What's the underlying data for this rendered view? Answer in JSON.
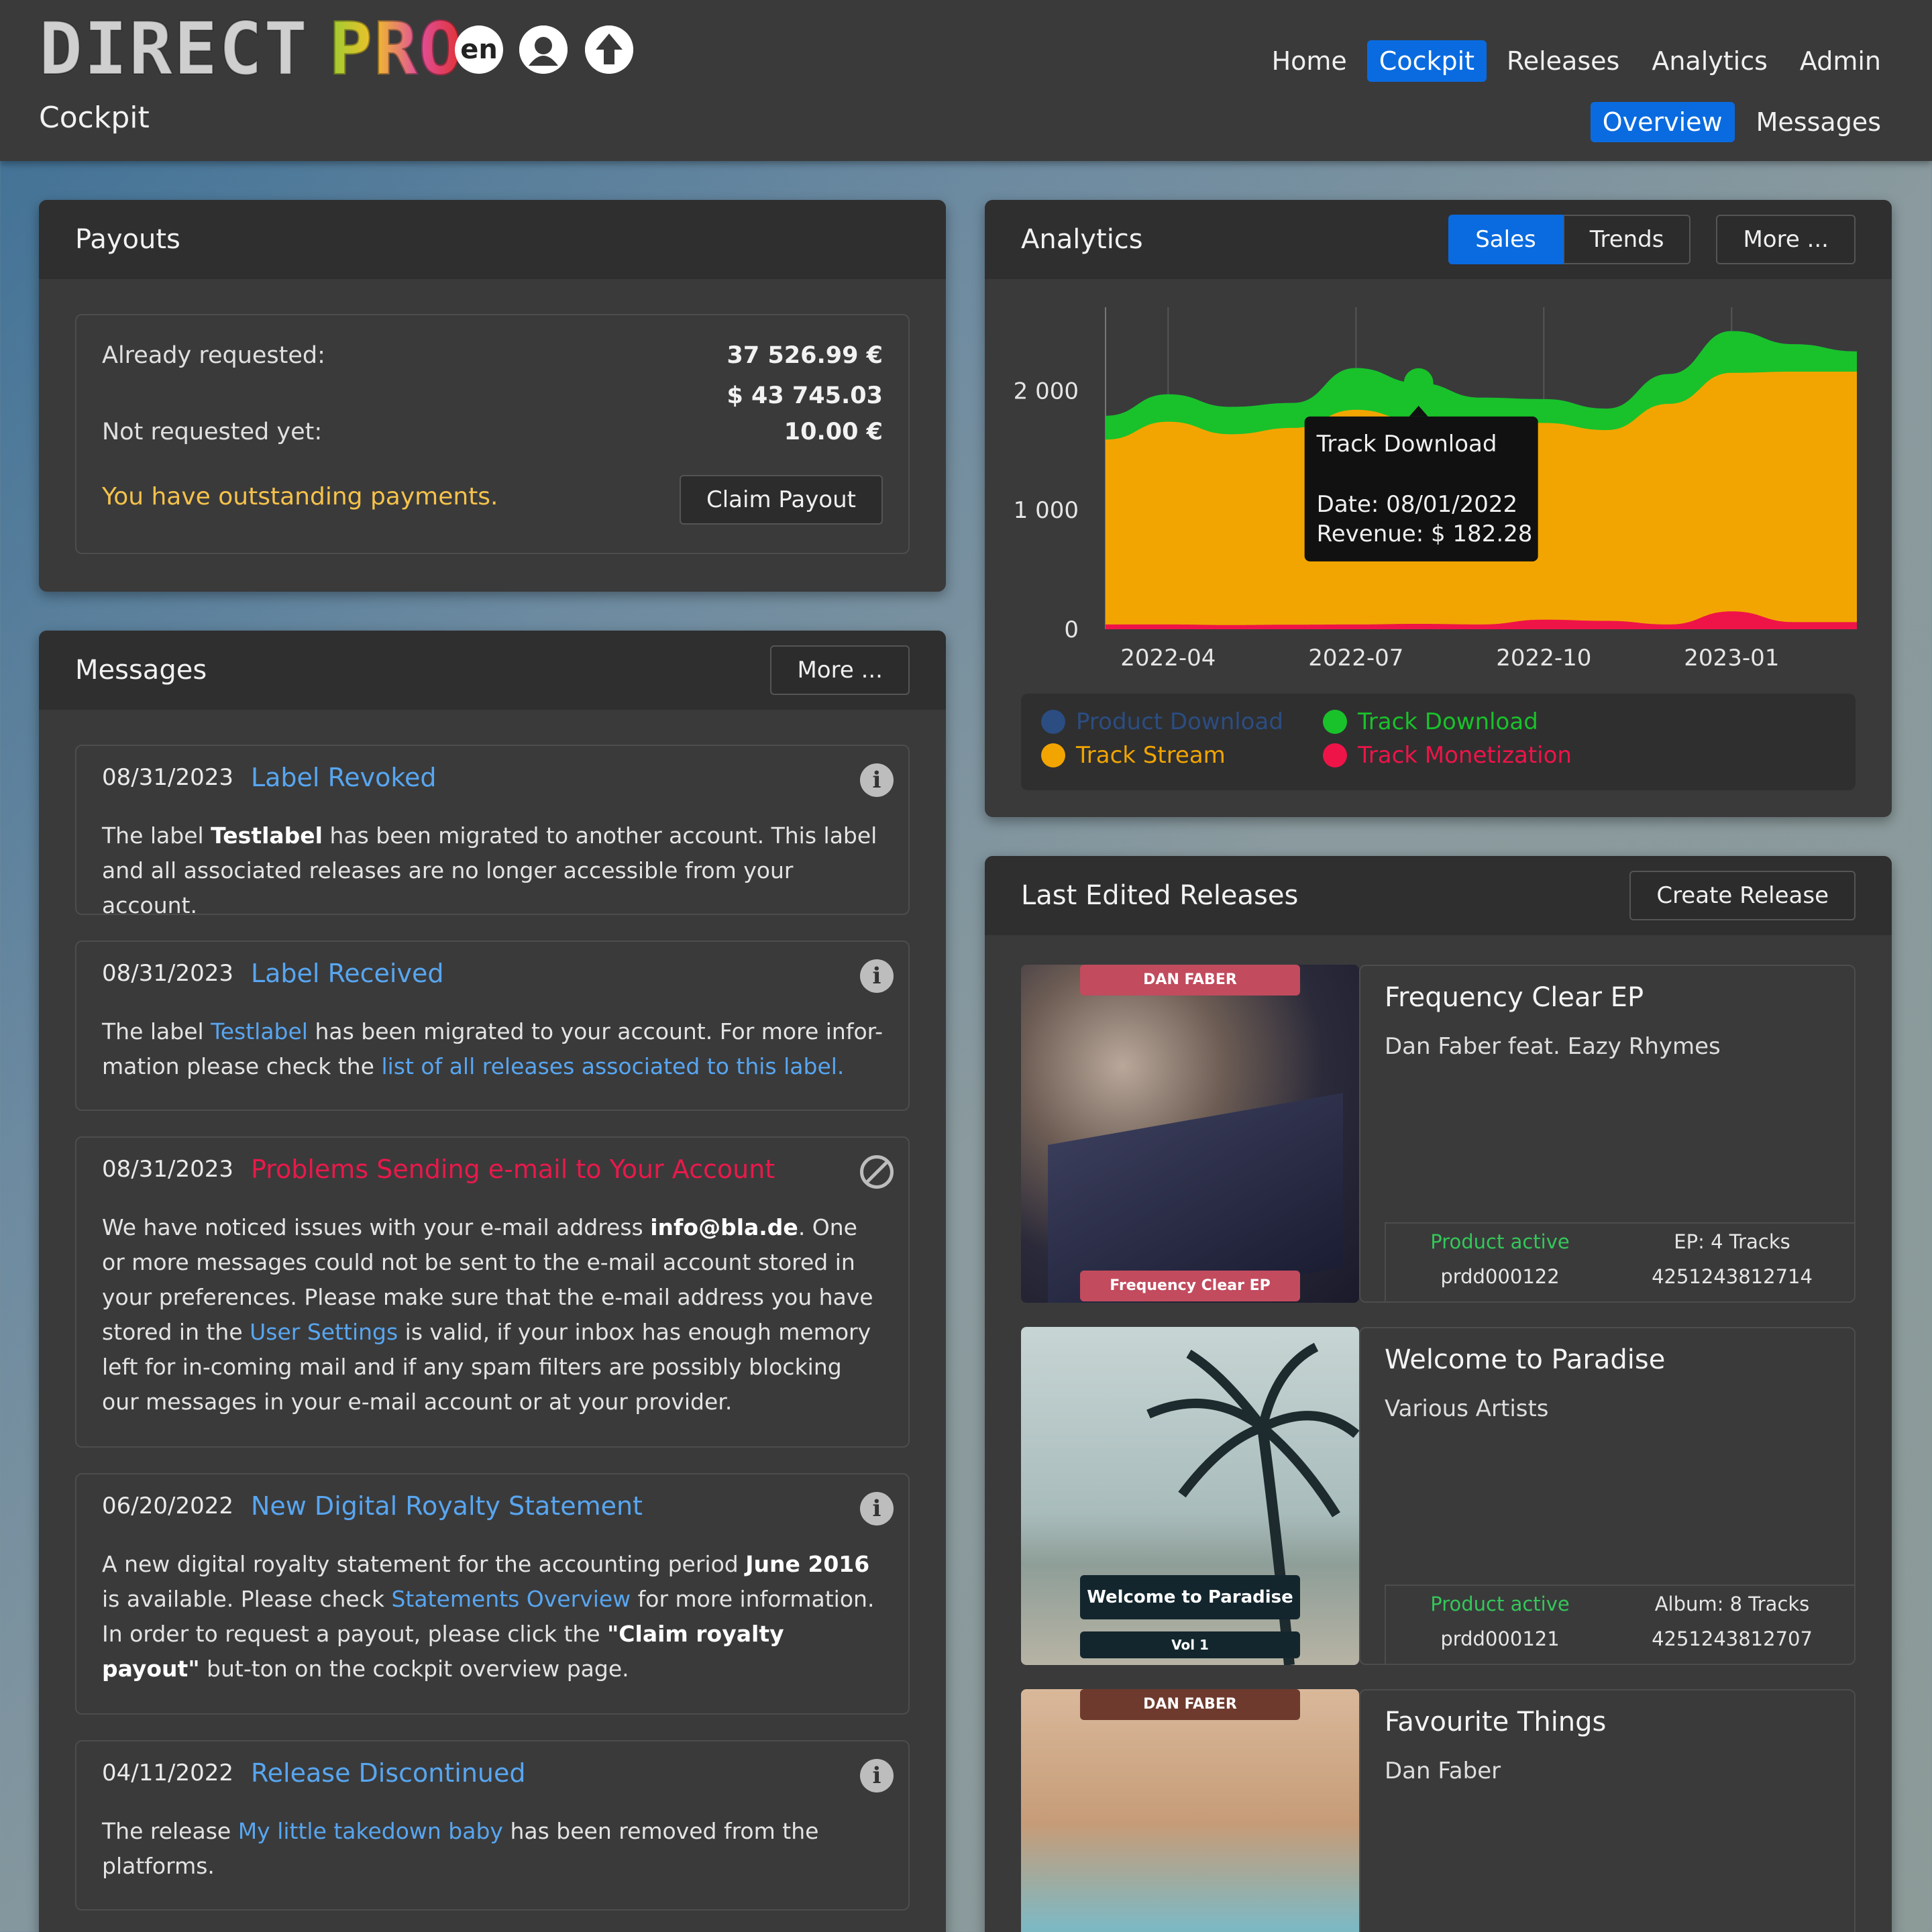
{
  "header": {
    "logo_word1": "DIRECT",
    "logo_word2": "PRO",
    "lang": "en",
    "page_title": "Cockpit",
    "nav": [
      "Home",
      "Cockpit",
      "Releases",
      "Analytics",
      "Admin"
    ],
    "nav_active": "Cockpit",
    "subnav": [
      "Overview",
      "Messages"
    ],
    "subnav_active": "Overview"
  },
  "payouts": {
    "title": "Payouts",
    "already_requested_label": "Already requested:",
    "already_requested_eur": "37 526.99 €",
    "already_requested_usd": "$ 43 745.03",
    "not_requested_label": "Not requested yet:",
    "not_requested_eur": "10.00 €",
    "notice": "You have outstanding payments.",
    "claim_label": "Claim Payout"
  },
  "messages": {
    "title": "Messages",
    "more_label": "More ...",
    "items": [
      {
        "date": "08/31/2023",
        "title": "Label Revoked",
        "icon": "info-icon",
        "body_parts": [
          "The label ",
          "Testlabel",
          " has been migrated to another account. This label and all associated releases are no longer accessible from your account."
        ]
      },
      {
        "date": "08/31/2023",
        "title": "Label Received",
        "icon": "info-icon",
        "body_parts": [
          "The label ",
          "Testlabel",
          " has been migrated to your account. For more infor-mation please check the ",
          "list of all releases associated to this label."
        ]
      },
      {
        "date": "08/31/2023",
        "title": "Problems Sending e-mail to Your Account",
        "icon": "ban-icon",
        "body_parts": [
          "We have noticed issues with your e-mail address ",
          "info@bla.de",
          ". One or more messages could not be sent to the e-mail account stored in your preferences. Please make sure that the e-mail address you have stored in the ",
          "User Settings",
          " is valid, if your inbox has enough memory left for in-coming mail and if any spam filters are possibly blocking our messages in your e-mail account or at your provider."
        ]
      },
      {
        "date": "06/20/2022",
        "title": "New Digital Royalty Statement",
        "icon": "info-icon",
        "body_parts": [
          "A new digital royalty statement for the accounting period ",
          "June 2016",
          " is available. Please check ",
          "Statements Overview",
          " for more information. In order to request a payout, please click the ",
          "\"Claim royalty payout\"",
          " but-ton on the cockpit overview page."
        ]
      },
      {
        "date": "04/11/2022",
        "title": "Release Discontinued",
        "icon": "info-icon",
        "body_parts": [
          "The release ",
          "My little takedown baby",
          " has been removed from the platforms."
        ]
      }
    ]
  },
  "analytics": {
    "title": "Analytics",
    "tabs": [
      "Sales",
      "Trends"
    ],
    "tab_active": "Sales",
    "more_label": "More ...",
    "tooltip": {
      "series": "Track Download",
      "date_line": "Date: 08/01/2022",
      "revenue_line": "Revenue: $ 182.28"
    },
    "legend": [
      {
        "name": "Product Download",
        "color": "#2b4d82"
      },
      {
        "name": "Track Download",
        "color": "#19c22a"
      },
      {
        "name": "Track Stream",
        "color": "#f2a500"
      },
      {
        "name": "Track Monetization",
        "color": "#ee1448"
      }
    ]
  },
  "chart_data": {
    "type": "area",
    "stacked": true,
    "x": [
      "2022-03",
      "2022-04",
      "2022-05",
      "2022-06",
      "2022-07",
      "2022-08",
      "2022-09",
      "2022-10",
      "2022-11",
      "2022-12",
      "2023-01",
      "2023-02",
      "2023-03"
    ],
    "xticks": [
      "2022-04",
      "2022-07",
      "2022-10",
      "2023-01"
    ],
    "yticks": [
      0,
      1000,
      2000
    ],
    "ylim": [
      0,
      2700
    ],
    "series": [
      {
        "name": "Track Monetization",
        "color": "#ee1448",
        "values": [
          40,
          40,
          35,
          38,
          40,
          45,
          40,
          80,
          70,
          40,
          150,
          60,
          60
        ]
      },
      {
        "name": "Track Stream",
        "color": "#f2a500",
        "values": [
          1550,
          1700,
          1600,
          1650,
          1800,
          1700,
          1720,
          1650,
          1600,
          1850,
          2000,
          2100,
          2100
        ]
      },
      {
        "name": "Track Download",
        "color": "#19c22a",
        "values": [
          200,
          230,
          230,
          210,
          350,
          320,
          182,
          200,
          180,
          250,
          350,
          230,
          170
        ]
      },
      {
        "name": "Product Download",
        "color": "#2b4d82",
        "values": [
          0,
          0,
          0,
          0,
          0,
          0,
          0,
          0,
          0,
          0,
          0,
          0,
          0
        ]
      }
    ]
  },
  "releases": {
    "title": "Last Edited Releases",
    "create_label": "Create Release",
    "items": [
      {
        "title": "Frequency Clear EP",
        "artist": "Dan Faber feat. Eazy Rhymes",
        "status": "Product active",
        "id": "prdd000122",
        "format": "EP: 4 Tracks",
        "ean": "4251243812714",
        "cover_top": "DAN FABER",
        "cover_bottom": "Frequency Clear EP"
      },
      {
        "title": "Welcome to Paradise",
        "artist": "Various Artists",
        "status": "Product active",
        "id": "prdd000121",
        "format": "Album: 8 Tracks",
        "ean": "4251243812707",
        "cover_bottom": "Welcome to Paradise",
        "cover_sub": "Vol 1"
      },
      {
        "title": "Favourite Things",
        "artist": "Dan Faber",
        "cover_top": "DAN FABER"
      }
    ]
  }
}
